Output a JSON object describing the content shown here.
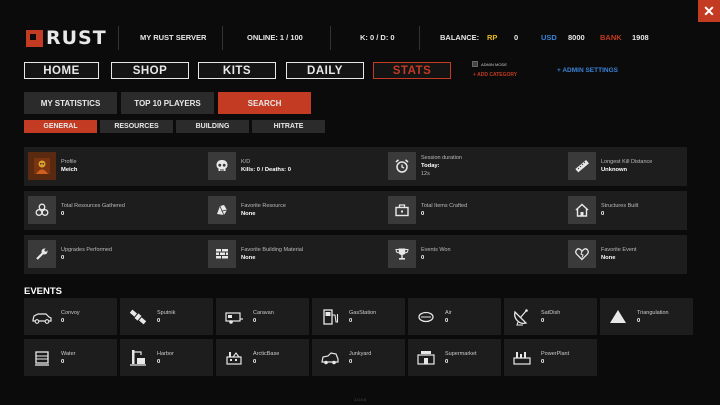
{
  "logo": {
    "text": "RUST"
  },
  "header": {
    "server_name": "MY RUST SERVER",
    "online": "ONLINE: 1 / 100",
    "kd": "K: 0  / D: 0",
    "balance_label": "BALANCE:",
    "rp_label": "RP",
    "rp_value": "0",
    "usd_label": "USD",
    "usd_value": "8000",
    "bank_label": "BANK",
    "bank_value": "1908",
    "close": "✕"
  },
  "nav": [
    "HOME",
    "SHOP",
    "KITS",
    "DAILY",
    "STATS"
  ],
  "admin": {
    "mode_label": "ADMIN MODE",
    "add_category": "+ ADD CATEGORY",
    "settings": "+ ADMIN SETTINGS"
  },
  "subtabs": [
    "MY STATISTICS",
    "TOP 10 PLAYERS",
    "SEARCH"
  ],
  "categories": [
    "GENERAL",
    "RESOURCES",
    "BUILDING",
    "HITRATE"
  ],
  "stats": [
    {
      "label": "Profile",
      "value": "Meich",
      "icon": "avatar"
    },
    {
      "label": "K/D",
      "value": "Kills: 0 / Deaths: 0",
      "icon": "skull-icon"
    },
    {
      "label": "Session duration",
      "value": "Today:",
      "value2": "12s",
      "icon": "alarm-clock-icon"
    },
    {
      "label": "Longest Kill Distance",
      "value": "Unknown",
      "icon": "ruler-icon"
    },
    {
      "label": "Total Resources Gathered",
      "value": "0",
      "icon": "resources-icon"
    },
    {
      "label": "Favorite Resource",
      "value": "None",
      "icon": "ore-icon"
    },
    {
      "label": "Total Items Crafted",
      "value": "0",
      "icon": "toolbox-icon"
    },
    {
      "label": "Structures Built",
      "value": "0",
      "icon": "house-icon"
    },
    {
      "label": "Upgrades Performed",
      "value": "0",
      "icon": "wrench-icon"
    },
    {
      "label": "Favorite Building Material",
      "value": "None",
      "icon": "bricks-icon"
    },
    {
      "label": "Events Won",
      "value": "0",
      "icon": "trophy-icon"
    },
    {
      "label": "Favorite Event",
      "value": "None",
      "icon": "heart-icon"
    }
  ],
  "events_title": "EVENTS",
  "events": [
    {
      "label": "Convoy",
      "value": "0",
      "icon": "convoy-icon"
    },
    {
      "label": "Sputnik",
      "value": "0",
      "icon": "satellite-icon"
    },
    {
      "label": "Caravan",
      "value": "0",
      "icon": "caravan-icon"
    },
    {
      "label": "GasStation",
      "value": "0",
      "icon": "gas-station-icon"
    },
    {
      "label": "Air",
      "value": "0",
      "icon": "air-icon"
    },
    {
      "label": "SatDish",
      "value": "0",
      "icon": "satellite-dish-icon"
    },
    {
      "label": "Triangulation",
      "value": "0",
      "icon": "triangle-icon"
    },
    {
      "label": "Water",
      "value": "0",
      "icon": "water-icon"
    },
    {
      "label": "Harbor",
      "value": "0",
      "icon": "harbor-icon"
    },
    {
      "label": "ArcticBase",
      "value": "0",
      "icon": "arctic-base-icon"
    },
    {
      "label": "Junkyard",
      "value": "0",
      "icon": "junkyard-icon"
    },
    {
      "label": "Supermarket",
      "value": "0",
      "icon": "supermarket-icon"
    },
    {
      "label": "PowerPlant",
      "value": "0",
      "icon": "power-plant-icon"
    }
  ],
  "footer": "1.0.0.0",
  "colors": {
    "accent": "#c23b22",
    "rp": "#e8b923",
    "usd": "#3b83d6",
    "bank": "#c23b22",
    "admin": "#3b83d6"
  }
}
